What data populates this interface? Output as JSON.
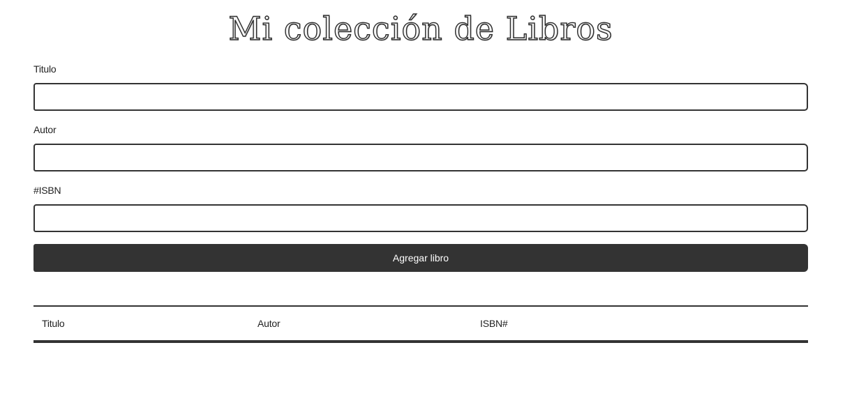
{
  "header": {
    "title": "Mi colección de Libros"
  },
  "form": {
    "fields": [
      {
        "label": "Titulo",
        "value": "",
        "placeholder": ""
      },
      {
        "label": "Autor",
        "value": "",
        "placeholder": ""
      },
      {
        "label": "#ISBN",
        "value": "",
        "placeholder": ""
      }
    ],
    "submit_label": "Agregar libro"
  },
  "table": {
    "columns": [
      "Titulo",
      "Autor",
      "ISBN#"
    ],
    "rows": []
  },
  "colors": {
    "primary_dark": "#333333",
    "background": "#ffffff",
    "text": "#222222"
  }
}
